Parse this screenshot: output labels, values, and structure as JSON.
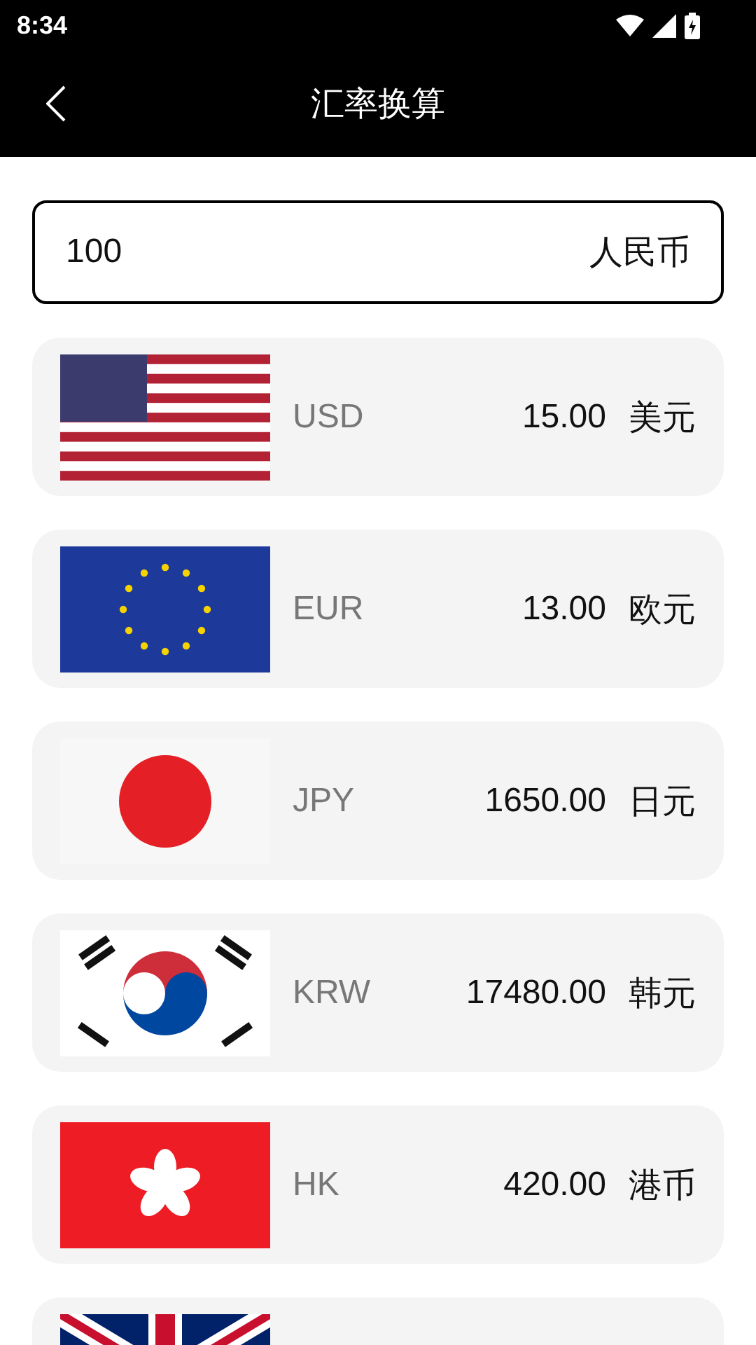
{
  "status_bar": {
    "time": "8:34"
  },
  "header": {
    "title": "汇率换算"
  },
  "amount_field": {
    "value": "100",
    "currency": "人民币"
  },
  "rates": [
    {
      "kind": "us",
      "code": "USD",
      "amount": "15.00",
      "name": "美元"
    },
    {
      "kind": "eu",
      "code": "EUR",
      "amount": "13.00",
      "name": "欧元"
    },
    {
      "kind": "jp",
      "code": "JPY",
      "amount": "1650.00",
      "name": "日元"
    },
    {
      "kind": "kr",
      "code": "KRW",
      "amount": "17480.00",
      "name": "韩元"
    },
    {
      "kind": "hk",
      "code": "HK",
      "amount": "420.00",
      "name": "港币"
    },
    {
      "kind": "gb"
    }
  ]
}
